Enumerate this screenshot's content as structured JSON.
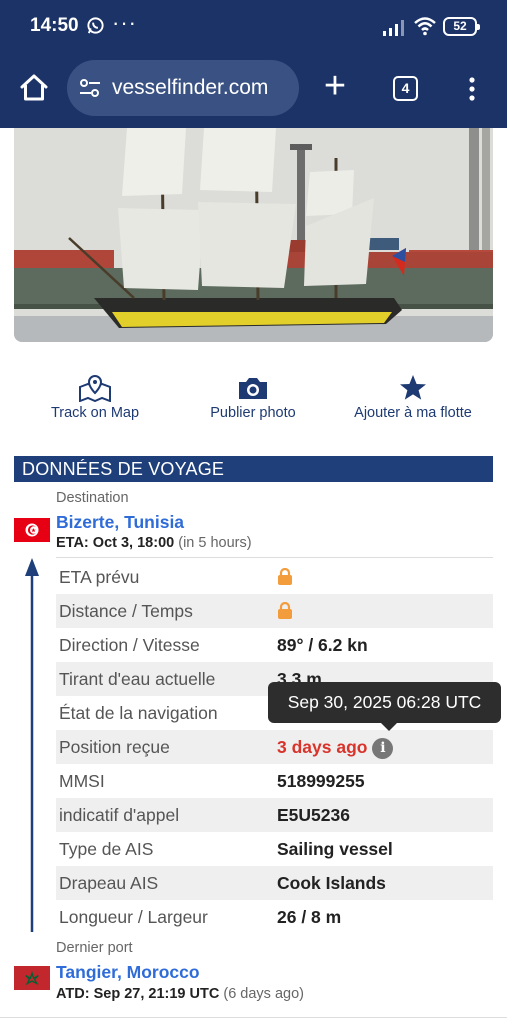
{
  "status_bar": {
    "time": "14:50",
    "battery": "52"
  },
  "browser": {
    "url": "vesselfinder.com",
    "tab_count": "4"
  },
  "actions": [
    {
      "label": "Track on Map",
      "icon": "map-pin-icon"
    },
    {
      "label": "Publier photo",
      "icon": "camera-icon"
    },
    {
      "label": "Ajouter à ma flotte",
      "icon": "star-icon"
    }
  ],
  "voyage": {
    "section_title": "DONNÉES DE VOYAGE",
    "destination_label": "Destination",
    "destination": "Bizerte, Tunisia",
    "eta_label": "ETA:",
    "eta_value": "Oct 3, 18:00",
    "eta_note": "(in 5 hours)",
    "last_port_label": "Dernier port",
    "last_port": "Tangier, Morocco",
    "atd_label": "ATD:",
    "atd_value": "Sep 27, 21:19 UTC",
    "atd_note": "(6 days ago)"
  },
  "table": {
    "rows": [
      {
        "key": "ETA prévu",
        "value": ""
      },
      {
        "key": "Distance / Temps",
        "value": ""
      },
      {
        "key": "Direction / Vitesse",
        "value": "89° / 6.2 kn"
      },
      {
        "key": "Tirant d'eau actuelle",
        "value": "3.3 m"
      },
      {
        "key": "État de la navigation",
        "value": ""
      },
      {
        "key": "Position reçue",
        "value": "3 days ago"
      },
      {
        "key": "MMSI",
        "value": "518999255"
      },
      {
        "key": "indicatif d'appel",
        "value": "E5U5236"
      },
      {
        "key": "Type de AIS",
        "value": "Sailing vessel"
      },
      {
        "key": "Drapeau AIS",
        "value": "Cook Islands"
      },
      {
        "key": "Longueur / Largeur",
        "value": "26 / 8 m"
      }
    ]
  },
  "tooltip": {
    "text": "Sep 30, 2025 06:28 UTC"
  },
  "colors": {
    "header_bg": "#1b3367",
    "section_bg": "#1e3f7a",
    "link": "#2f6cd8",
    "warn": "#f39c3c",
    "alert": "#d8342c"
  }
}
